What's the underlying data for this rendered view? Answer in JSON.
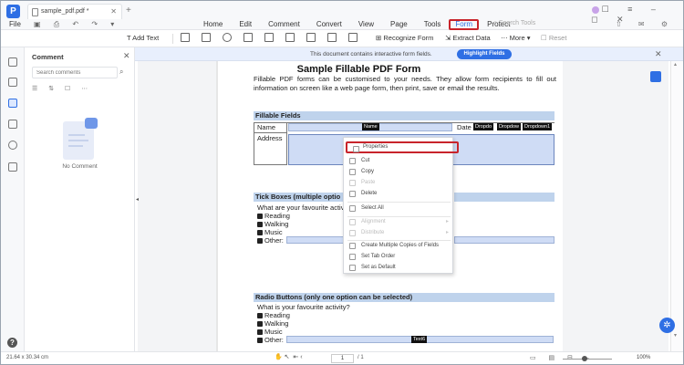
{
  "tab": {
    "title": "sample_pdf.pdf *"
  },
  "menu": {
    "file": "File",
    "items": [
      "Home",
      "Edit",
      "Comment",
      "Convert",
      "View",
      "Page",
      "Tools",
      "Form",
      "Protect"
    ],
    "search_placeholder": "Search Tools"
  },
  "toolbar": {
    "add_text": "Add Text",
    "recognize_form": "Recognize Form",
    "extract_data": "Extract Data",
    "more": "More",
    "reset": "Reset"
  },
  "comment_panel": {
    "title": "Comment",
    "search_placeholder": "Search comments",
    "empty_text": "No Comment"
  },
  "infobar": {
    "message": "This document contains interactive form fields.",
    "highlight_label": "Highlight Fields"
  },
  "pdf": {
    "title": "Sample Fillable PDF Form",
    "intro": "Fillable PDF forms can be customised to your needs. They allow form recipients to fill out information on screen like a web page form, then print, save or email the results.",
    "fillable_header": "Fillable Fields",
    "name_label": "Name",
    "name_tag": "Name",
    "date_label": "Date",
    "dropdown_tags": [
      "Dropdo",
      "Dropdow",
      "Dropdown1"
    ],
    "address_label": "Address",
    "tick_header": "Tick Boxes (multiple optio",
    "tick_question": "What are your favourite activi",
    "tick_options": [
      "Reading",
      "Walking",
      "Music",
      "Other:"
    ],
    "radio_header": "Radio Buttons (only one option can be selected)",
    "radio_question": "What is your favourite activity?",
    "radio_options": [
      "Reading",
      "Walking",
      "Music",
      "Other:"
    ],
    "text_tag": "Text6"
  },
  "context_menu": {
    "items": [
      {
        "label": "Properties",
        "disabled": false
      },
      {
        "label": "Cut",
        "disabled": false
      },
      {
        "label": "Copy",
        "disabled": false
      },
      {
        "label": "Paste",
        "disabled": true
      },
      {
        "label": "Delete",
        "disabled": false
      },
      {
        "label": "Select All",
        "disabled": false
      },
      {
        "label": "Alignment",
        "disabled": true
      },
      {
        "label": "Distribute",
        "disabled": true
      },
      {
        "label": "Create Multiple Copies of Fields",
        "disabled": false
      },
      {
        "label": "Set Tab Order",
        "disabled": false
      },
      {
        "label": "Set as Default",
        "disabled": false
      }
    ]
  },
  "status": {
    "dimensions": "21.64 x 30.34 cm",
    "page_current": "1",
    "page_total": "/ 1",
    "zoom": "100%"
  },
  "colors": {
    "accent": "#2f6fe4",
    "highlight_border": "#c8242b",
    "field_fill": "#cfdcf5",
    "section_fill": "#bfd3ec"
  }
}
